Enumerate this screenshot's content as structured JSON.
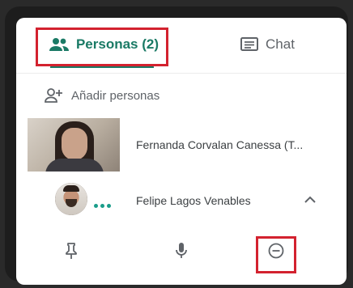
{
  "tabs": {
    "people_label": "Personas (2)",
    "people_icon": "people-icon",
    "chat_label": "Chat",
    "chat_icon": "chat-icon"
  },
  "add_people": {
    "label": "Añadir personas",
    "icon": "add-person-icon"
  },
  "participants": [
    {
      "name": "Fernanda Corvalan Canessa (T...",
      "media": "video-thumbnail"
    },
    {
      "name": "Felipe Lagos Venables",
      "media": "avatar",
      "speaking": true
    }
  ],
  "actions": {
    "pin_icon": "pin-icon",
    "mic_icon": "microphone-icon",
    "remove_icon": "remove-circle-icon"
  },
  "colors": {
    "accent": "#1a7a65",
    "highlight": "#d3222f",
    "text": "#3c4043",
    "muted": "#5f6368",
    "speaking": "#1a9d8a"
  }
}
